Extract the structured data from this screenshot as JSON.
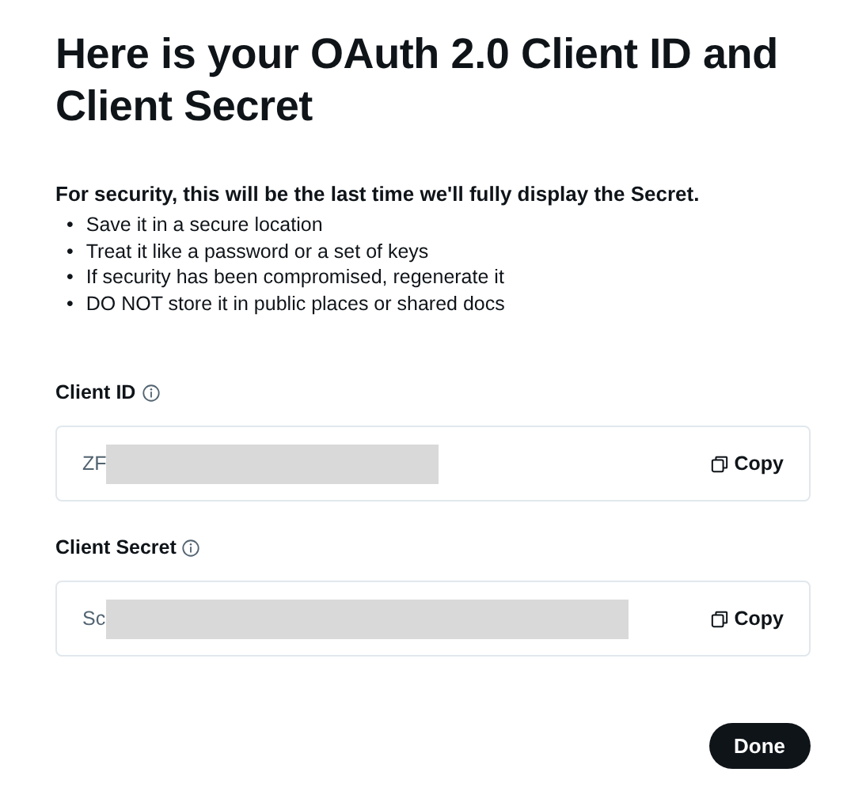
{
  "title": "Here is your OAuth 2.0 Client ID and Client Secret",
  "notice": "For security, this will be the last time we'll fully display the Secret.",
  "tips": [
    {
      "marker": "•",
      "text": "Save it in a secure location"
    },
    {
      "marker": "•",
      "text": "Treat it like a password or a set of keys"
    },
    {
      "marker": "•",
      "text": "If security has been compromised, regenerate it"
    },
    {
      "marker": "•",
      "text": "DO NOT store it in public places or shared docs"
    }
  ],
  "fields": [
    {
      "label": "Client ID",
      "value": "ZF",
      "redacted": true,
      "copy": "Copy"
    },
    {
      "label": "Client Secret",
      "value": "Sc",
      "redacted": true,
      "copy": "Copy"
    }
  ],
  "done": "Done"
}
